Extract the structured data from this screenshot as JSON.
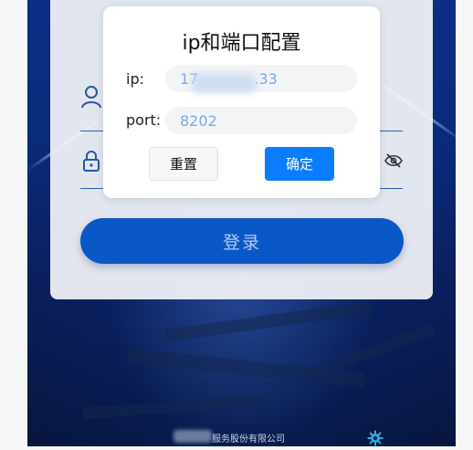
{
  "login": {
    "submit_label": "登录",
    "footer_company": "服务股份有限公司"
  },
  "dialog": {
    "title": "ip和端口配置",
    "ip_label": "ip:",
    "ip_value": "17            .33",
    "port_label": "port:",
    "port_value": "8202",
    "reset_label": "重置",
    "confirm_label": "确定"
  },
  "icons": {
    "user": "user-icon",
    "lock": "lock-icon",
    "eye": "eye-off-icon",
    "settings": "gear-icon"
  },
  "colors": {
    "primary": "#0a7cff",
    "login_button": "#0a58c8",
    "background_blue": "#0a2a78",
    "input_text": "#7aa9e6"
  }
}
